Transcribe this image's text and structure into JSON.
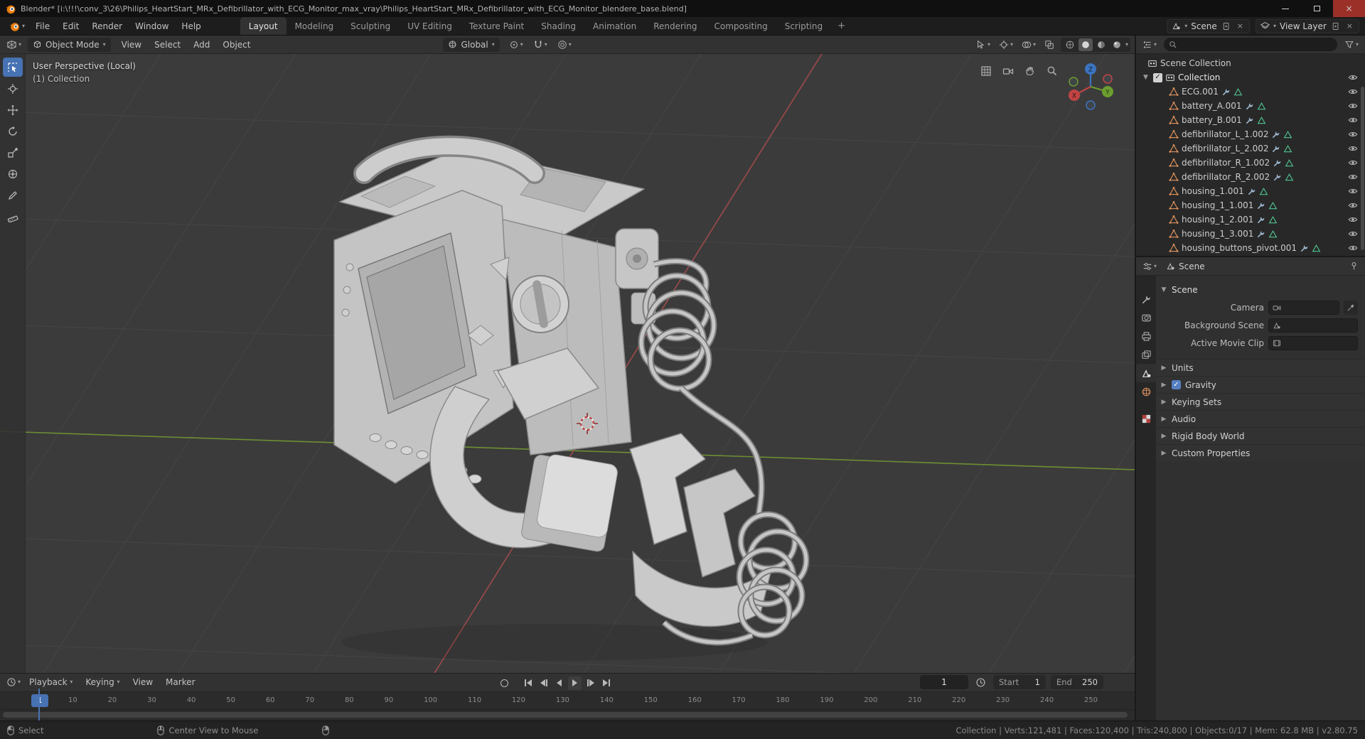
{
  "titlebar": {
    "title": "Blender* [i:\\!!!\\conv_3\\26\\Philips_HeartStart_MRx_Defibrillator_with_ECG_Monitor_max_vray\\Philips_HeartStart_MRx_Defibrillator_with_ECG_Monitor_blendere_base.blend]"
  },
  "topbar": {
    "menus": [
      "File",
      "Edit",
      "Render",
      "Window",
      "Help"
    ],
    "workspaces": [
      {
        "label": "Layout",
        "active": true
      },
      {
        "label": "Modeling",
        "active": false
      },
      {
        "label": "Sculpting",
        "active": false
      },
      {
        "label": "UV Editing",
        "active": false
      },
      {
        "label": "Texture Paint",
        "active": false
      },
      {
        "label": "Shading",
        "active": false
      },
      {
        "label": "Animation",
        "active": false
      },
      {
        "label": "Rendering",
        "active": false
      },
      {
        "label": "Compositing",
        "active": false
      },
      {
        "label": "Scripting",
        "active": false
      }
    ],
    "new_workspace_label": "+",
    "scene_label": "Scene",
    "view_layer_label": "View Layer"
  },
  "viewport_header": {
    "mode": "Object Mode",
    "menus": [
      "View",
      "Select",
      "Add",
      "Object"
    ],
    "orientation": "Global"
  },
  "viewport": {
    "view_label": "User Perspective (Local)",
    "collection_label": "(1) Collection",
    "gizmo": {
      "x": "X",
      "y": "Y",
      "z": "Z"
    }
  },
  "outliner": {
    "scene_collection_label": "Scene Collection",
    "collection_label": "Collection",
    "objects": [
      "ECG.001",
      "battery_A.001",
      "battery_B.001",
      "defibrillator_L_1.002",
      "defibrillator_L_2.002",
      "defibrillator_R_1.002",
      "defibrillator_R_2.002",
      "housing_1.001",
      "housing_1_1.001",
      "housing_1_2.001",
      "housing_1_3.001",
      "housing_buttons_pivot.001"
    ]
  },
  "properties": {
    "breadcrumb": "Scene",
    "scene_panel_title": "Scene",
    "scene_fields": [
      {
        "label": "Camera"
      },
      {
        "label": "Background Scene"
      },
      {
        "label": "Active Movie Clip"
      }
    ],
    "panels": [
      "Units",
      "Gravity",
      "Keying Sets",
      "Audio",
      "Rigid Body World",
      "Custom Properties"
    ],
    "gravity_checked": true
  },
  "timeline": {
    "menus": [
      "Playback",
      "Keying",
      "View",
      "Marker"
    ],
    "current_frame": "1",
    "playhead_frame": "1",
    "start_label": "Start",
    "start_value": "1",
    "end_label": "End",
    "end_value": "250",
    "ticks": [
      "10",
      "20",
      "30",
      "40",
      "50",
      "60",
      "70",
      "80",
      "90",
      "100",
      "110",
      "120",
      "130",
      "140",
      "150",
      "160",
      "170",
      "180",
      "190",
      "200",
      "210",
      "220",
      "230",
      "240",
      "250"
    ]
  },
  "statusbar": {
    "select_hint": "Select",
    "center_hint": "Center View to Mouse",
    "stats": "Collection | Verts:121,481 | Faces:120,400 | Tris:240,800 | Objects:0/17 | Mem: 62.8 MB | v2.80.75"
  },
  "colors": {
    "accent_blue": "#4772b3",
    "blender_orange": "#e87d0d",
    "axis_x_red": "#9e4a4a",
    "axis_y_green": "#6d8f33",
    "mesh_icon_orange": "#e0925c",
    "modifier_icon_blue": "#9db8d0",
    "data_icon_green": "#4fc48f",
    "checkbox_blue": "#5680c2"
  }
}
